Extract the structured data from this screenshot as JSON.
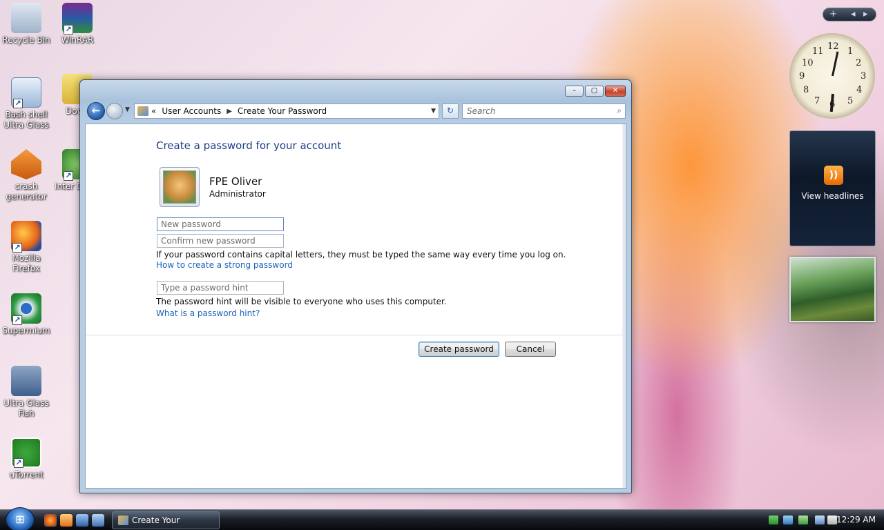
{
  "desktop": {
    "icons": [
      {
        "label": "Recycle Bin",
        "icon": "recycle-bin-icon"
      },
      {
        "label": "WinRAR",
        "icon": "winrar-icon"
      },
      {
        "label": "Bash shell Ultra Glass",
        "icon": "bash-shell-icon"
      },
      {
        "label": "Down",
        "icon": "folder-icon"
      },
      {
        "label": "crash generator",
        "icon": "crash-generator-icon"
      },
      {
        "label": "Inter Down",
        "icon": "internet-download-icon"
      },
      {
        "label": "Mozilla Firefox",
        "icon": "firefox-icon"
      },
      {
        "label": "Supermium",
        "icon": "supermium-icon"
      },
      {
        "label": "Ultra Glass Fish",
        "icon": "fish-icon"
      },
      {
        "label": "uTorrent",
        "icon": "utorrent-icon"
      }
    ]
  },
  "window": {
    "buttons": {
      "minimize": "–",
      "maximize": "▢",
      "close": "✕"
    },
    "nav": {
      "back": "←",
      "breadcrumb_prefix": "«",
      "breadcrumb": [
        "User Accounts",
        "Create Your Password"
      ],
      "search_placeholder": "Search",
      "refresh": "↻"
    },
    "content": {
      "heading": "Create a password for your account",
      "user_name": "FPE Oliver",
      "user_role": "Administrator",
      "new_password_placeholder": "New password",
      "confirm_password_placeholder": "Confirm new password",
      "caps_note": "If your password contains capital letters, they must be typed the same way every time you log on.",
      "strong_password_link": "How to create a strong password",
      "hint_placeholder": "Type a password hint",
      "hint_note": "The password hint will be visible to everyone who uses this computer.",
      "hint_link": "What is a password hint?",
      "create_button": "Create password",
      "cancel_button": "Cancel"
    }
  },
  "gadgets": {
    "control": {
      "add": "+",
      "prev": "◂",
      "next": "▸"
    },
    "clock": {
      "numbers": [
        "12",
        "1",
        "2",
        "3",
        "4",
        "5",
        "6",
        "7",
        "8",
        "9",
        "10",
        "11"
      ]
    },
    "feed": {
      "label": "View headlines"
    }
  },
  "taskbar": {
    "start": "⊞",
    "active_task": "Create Your Password",
    "time": "12:29 AM"
  },
  "colors": {
    "link": "#1a63b8",
    "heading": "#1e3e87"
  }
}
